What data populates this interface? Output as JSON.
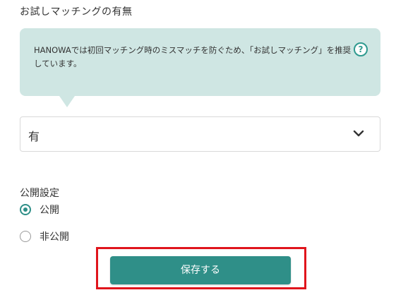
{
  "section": {
    "title": "お試しマッチングの有無"
  },
  "info": {
    "text": "HANOWAでは初回マッチング時のミスマッチを防ぐため、「お試しマッチング」を推奨しています。",
    "help_icon_glyph": "?",
    "help_icon": "question-circle-icon"
  },
  "select": {
    "value": "有",
    "icon": "chevron-down-icon"
  },
  "visibility": {
    "label": "公開設定",
    "options": [
      {
        "label": "公開",
        "checked": true
      },
      {
        "label": "非公開",
        "checked": false
      }
    ]
  },
  "actions": {
    "save_label": "保存する"
  },
  "colors": {
    "accent": "#2f8f88",
    "bubble_bg": "#cfe6e3",
    "highlight": "#e0151c"
  }
}
